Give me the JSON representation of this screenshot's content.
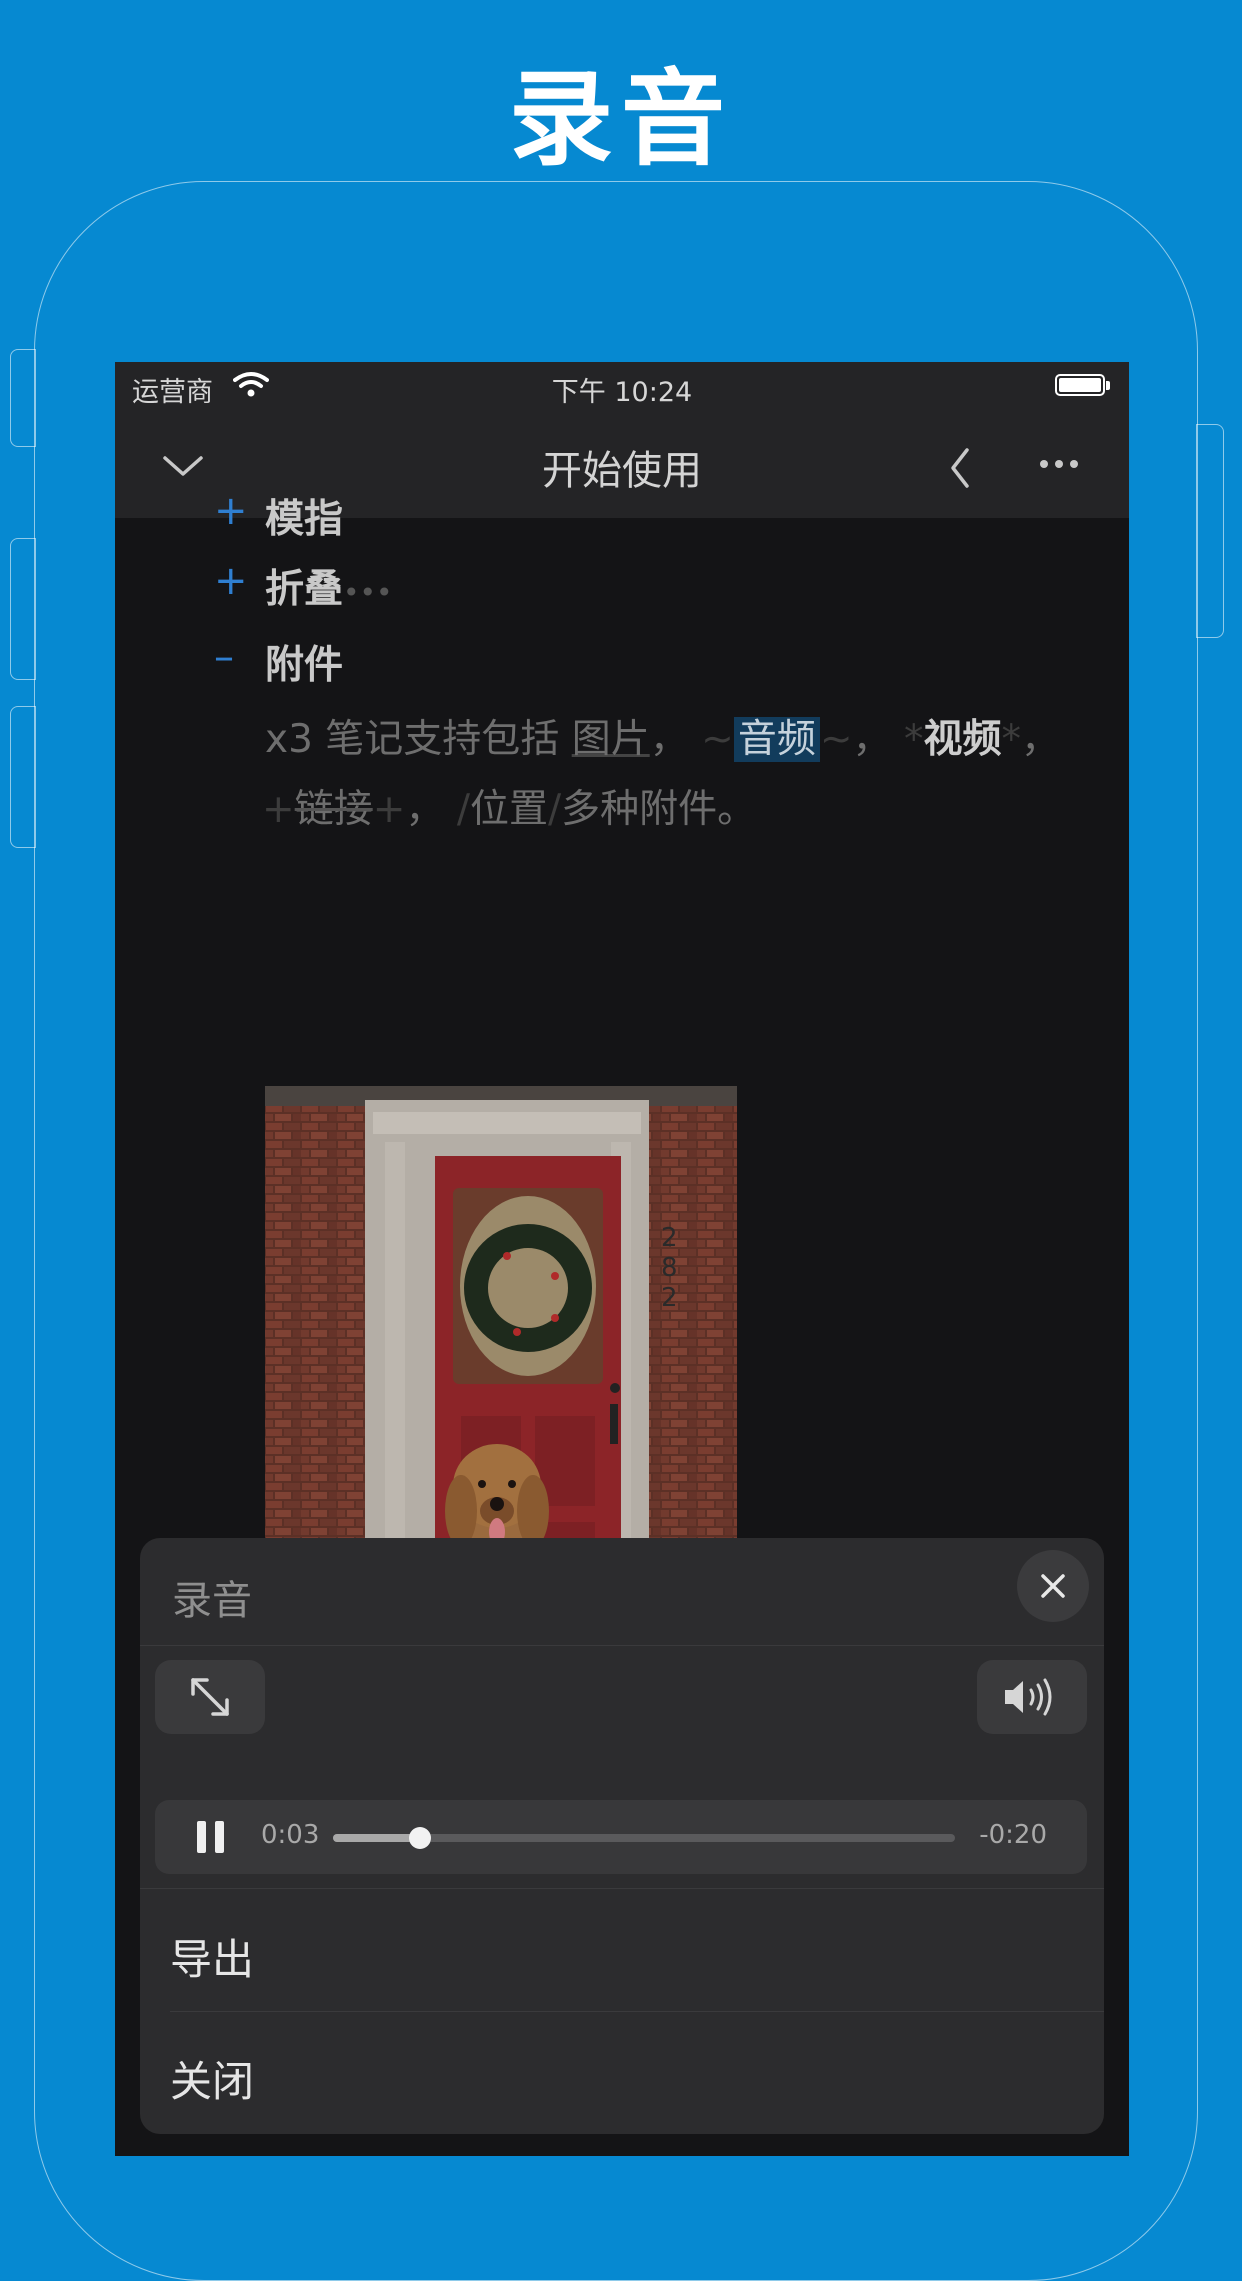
{
  "headline": "录音",
  "status_bar": {
    "carrier": "运营商",
    "time": "下午 10:24"
  },
  "navbar": {
    "title": "开始使用"
  },
  "outline": {
    "partial_item": "模指",
    "items": [
      {
        "marker": "+",
        "label": "折叠",
        "suffix": "•••"
      },
      {
        "marker": "–",
        "label": "附件"
      }
    ]
  },
  "paragraph": {
    "prefix": "x3 笔记支持包括",
    "image_link": "图片",
    "comma1": "，",
    "audio_mark": "~",
    "audio": "音频",
    "comma2": "，",
    "video_mark": "*",
    "video": "视频",
    "comma3": "，",
    "link_mark": "+",
    "link": "链接",
    "comma4": "，",
    "loc_mark": "/",
    "location": "位置",
    "suffix": "多种附件。"
  },
  "recording_sheet": {
    "title": "录音",
    "elapsed": "0:03",
    "remaining": "-0:20",
    "progress": 0.14,
    "menu": [
      "导出",
      "关闭"
    ]
  },
  "icons": {
    "close": "close-icon",
    "expand": "expand-arrows-icon",
    "volume": "speaker-volume-icon",
    "pause": "pause-icon",
    "back": "chevron-left-icon",
    "more": "more-dots-icon",
    "collapse": "chevron-down-icon"
  },
  "colors": {
    "background": "#0689d1",
    "accent": "#2f7fd1",
    "highlight": "#123c5c"
  }
}
